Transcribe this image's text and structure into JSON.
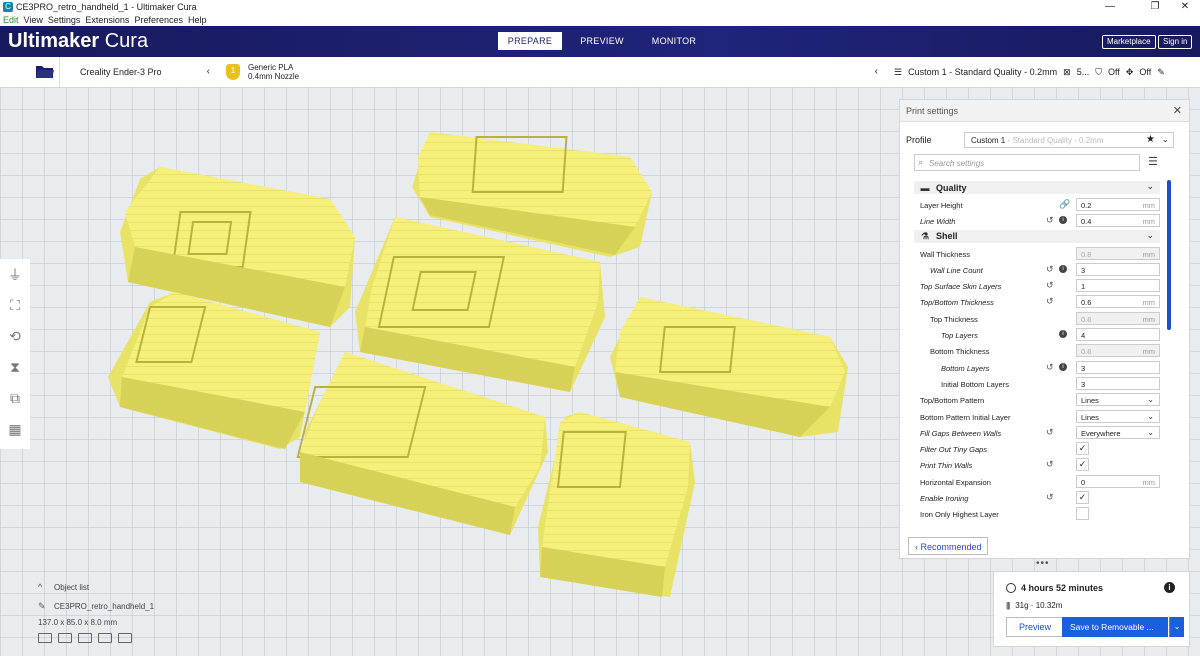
{
  "window": {
    "title": "CE3PRO_retro_handheld_1 - Ultimaker Cura",
    "minimize": "—",
    "maximize": "❐",
    "close": "✕"
  },
  "menu": [
    "Edit",
    "View",
    "Settings",
    "Extensions",
    "Preferences",
    "Help"
  ],
  "header": {
    "brand_bold": "Ultimaker",
    "brand_light": "Cura",
    "tabs": [
      {
        "label": "PREPARE",
        "active": true
      },
      {
        "label": "PREVIEW",
        "active": false
      },
      {
        "label": "MONITOR",
        "active": false
      }
    ],
    "marketplace": "Marketplace",
    "signin": "Sign in"
  },
  "toolbar": {
    "printer": "Creality Ender-3 Pro",
    "material_badge": "1",
    "material_name": "Generic PLA",
    "nozzle": "0.4mm Nozzle",
    "profile": "Custom 1 - Standard Quality - 0.2mm",
    "infill": "5...",
    "support": "Off",
    "adhesion": "Off"
  },
  "object_list": {
    "title": "Object list",
    "file": "CE3PRO_retro_handheld_1",
    "dims": "137.0 x 85.0 x 8.0 mm"
  },
  "print_settings": {
    "title": "Print settings",
    "profile_label": "Profile",
    "profile_value": "Custom 1",
    "profile_sub": "- Standard Quality - 0.2mm",
    "search_placeholder": "Search settings",
    "quality_label": "Quality",
    "shell_label": "Shell",
    "rows": [
      {
        "label": "Layer Height",
        "value": "0.2",
        "unit": "mm"
      },
      {
        "label": "Line Width",
        "value": "0.4",
        "unit": "mm"
      },
      {
        "label": "Wall Thickness",
        "value": "0.8",
        "unit": "mm"
      },
      {
        "label": "Wall Line Count",
        "value": "3"
      },
      {
        "label": "Top Surface Skin Layers",
        "value": "1"
      },
      {
        "label": "Top/Bottom Thickness",
        "value": "0.6",
        "unit": "mm"
      },
      {
        "label": "Top Thickness",
        "value": "0.6",
        "unit": "mm"
      },
      {
        "label": "Top Layers",
        "value": "4"
      },
      {
        "label": "Bottom Thickness",
        "value": "0.6",
        "unit": "mm"
      },
      {
        "label": "Bottom Layers",
        "value": "3"
      },
      {
        "label": "Initial Bottom Layers",
        "value": "3"
      },
      {
        "label": "Top/Bottom Pattern",
        "value": "Lines"
      },
      {
        "label": "Bottom Pattern Initial Layer",
        "value": "Lines"
      },
      {
        "label": "Fill Gaps Between Walls",
        "value": "Everywhere"
      },
      {
        "label": "Filter Out Tiny Gaps",
        "value": "✓"
      },
      {
        "label": "Print Thin Walls",
        "value": "✓"
      },
      {
        "label": "Horizontal Expansion",
        "value": "0",
        "unit": "mm"
      },
      {
        "label": "Enable Ironing",
        "value": "✓"
      },
      {
        "label": "Iron Only Highest Layer",
        "value": ""
      }
    ],
    "recommended": "Recommended"
  },
  "action_panel": {
    "time": "4 hours 52 minutes",
    "material": "31g · 10.32m",
    "preview": "Preview",
    "save": "Save to Removable ..."
  },
  "colors": {
    "header": "#1c1f6b",
    "model": "#f6f07a",
    "accent": "#1c5ee0",
    "material": "#e8c21a"
  }
}
